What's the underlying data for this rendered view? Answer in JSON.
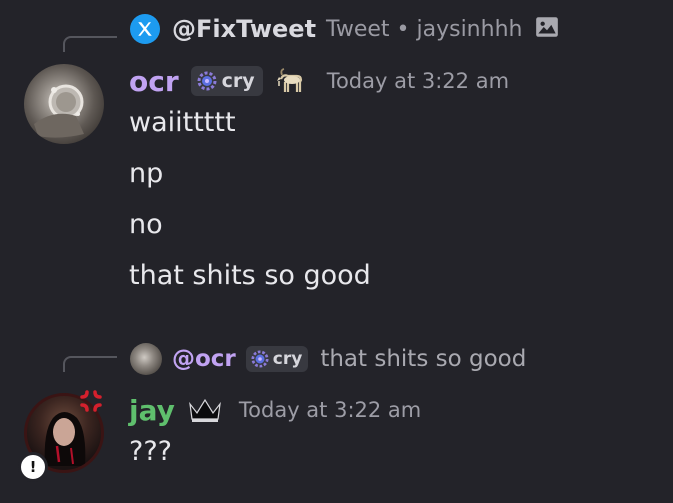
{
  "messages": [
    {
      "reply": {
        "author": "@FixTweet",
        "meta": "Tweet • jaysinhhh",
        "icon": "x-logo-icon",
        "attachment_icon": "image-icon"
      },
      "author": "ocr",
      "author_color": "#c1a3f2",
      "tag": "cry",
      "tag_icon": "gear-badge-icon",
      "decoration_icon": "goat-icon",
      "timestamp": "Today at 3:22 am",
      "lines": [
        "waiittttt",
        "np",
        "no",
        "that shits so good"
      ]
    },
    {
      "reply": {
        "author": "@ocr",
        "author_color": "#c1a3f2",
        "tag": "cry",
        "text": "that shits so good"
      },
      "author": "jay",
      "author_color": "#5fbf6d",
      "decoration_icon": "crown-icon",
      "timestamp": "Today at 3:22 am",
      "lines": [
        "???"
      ],
      "avatar_badge": "!"
    }
  ]
}
